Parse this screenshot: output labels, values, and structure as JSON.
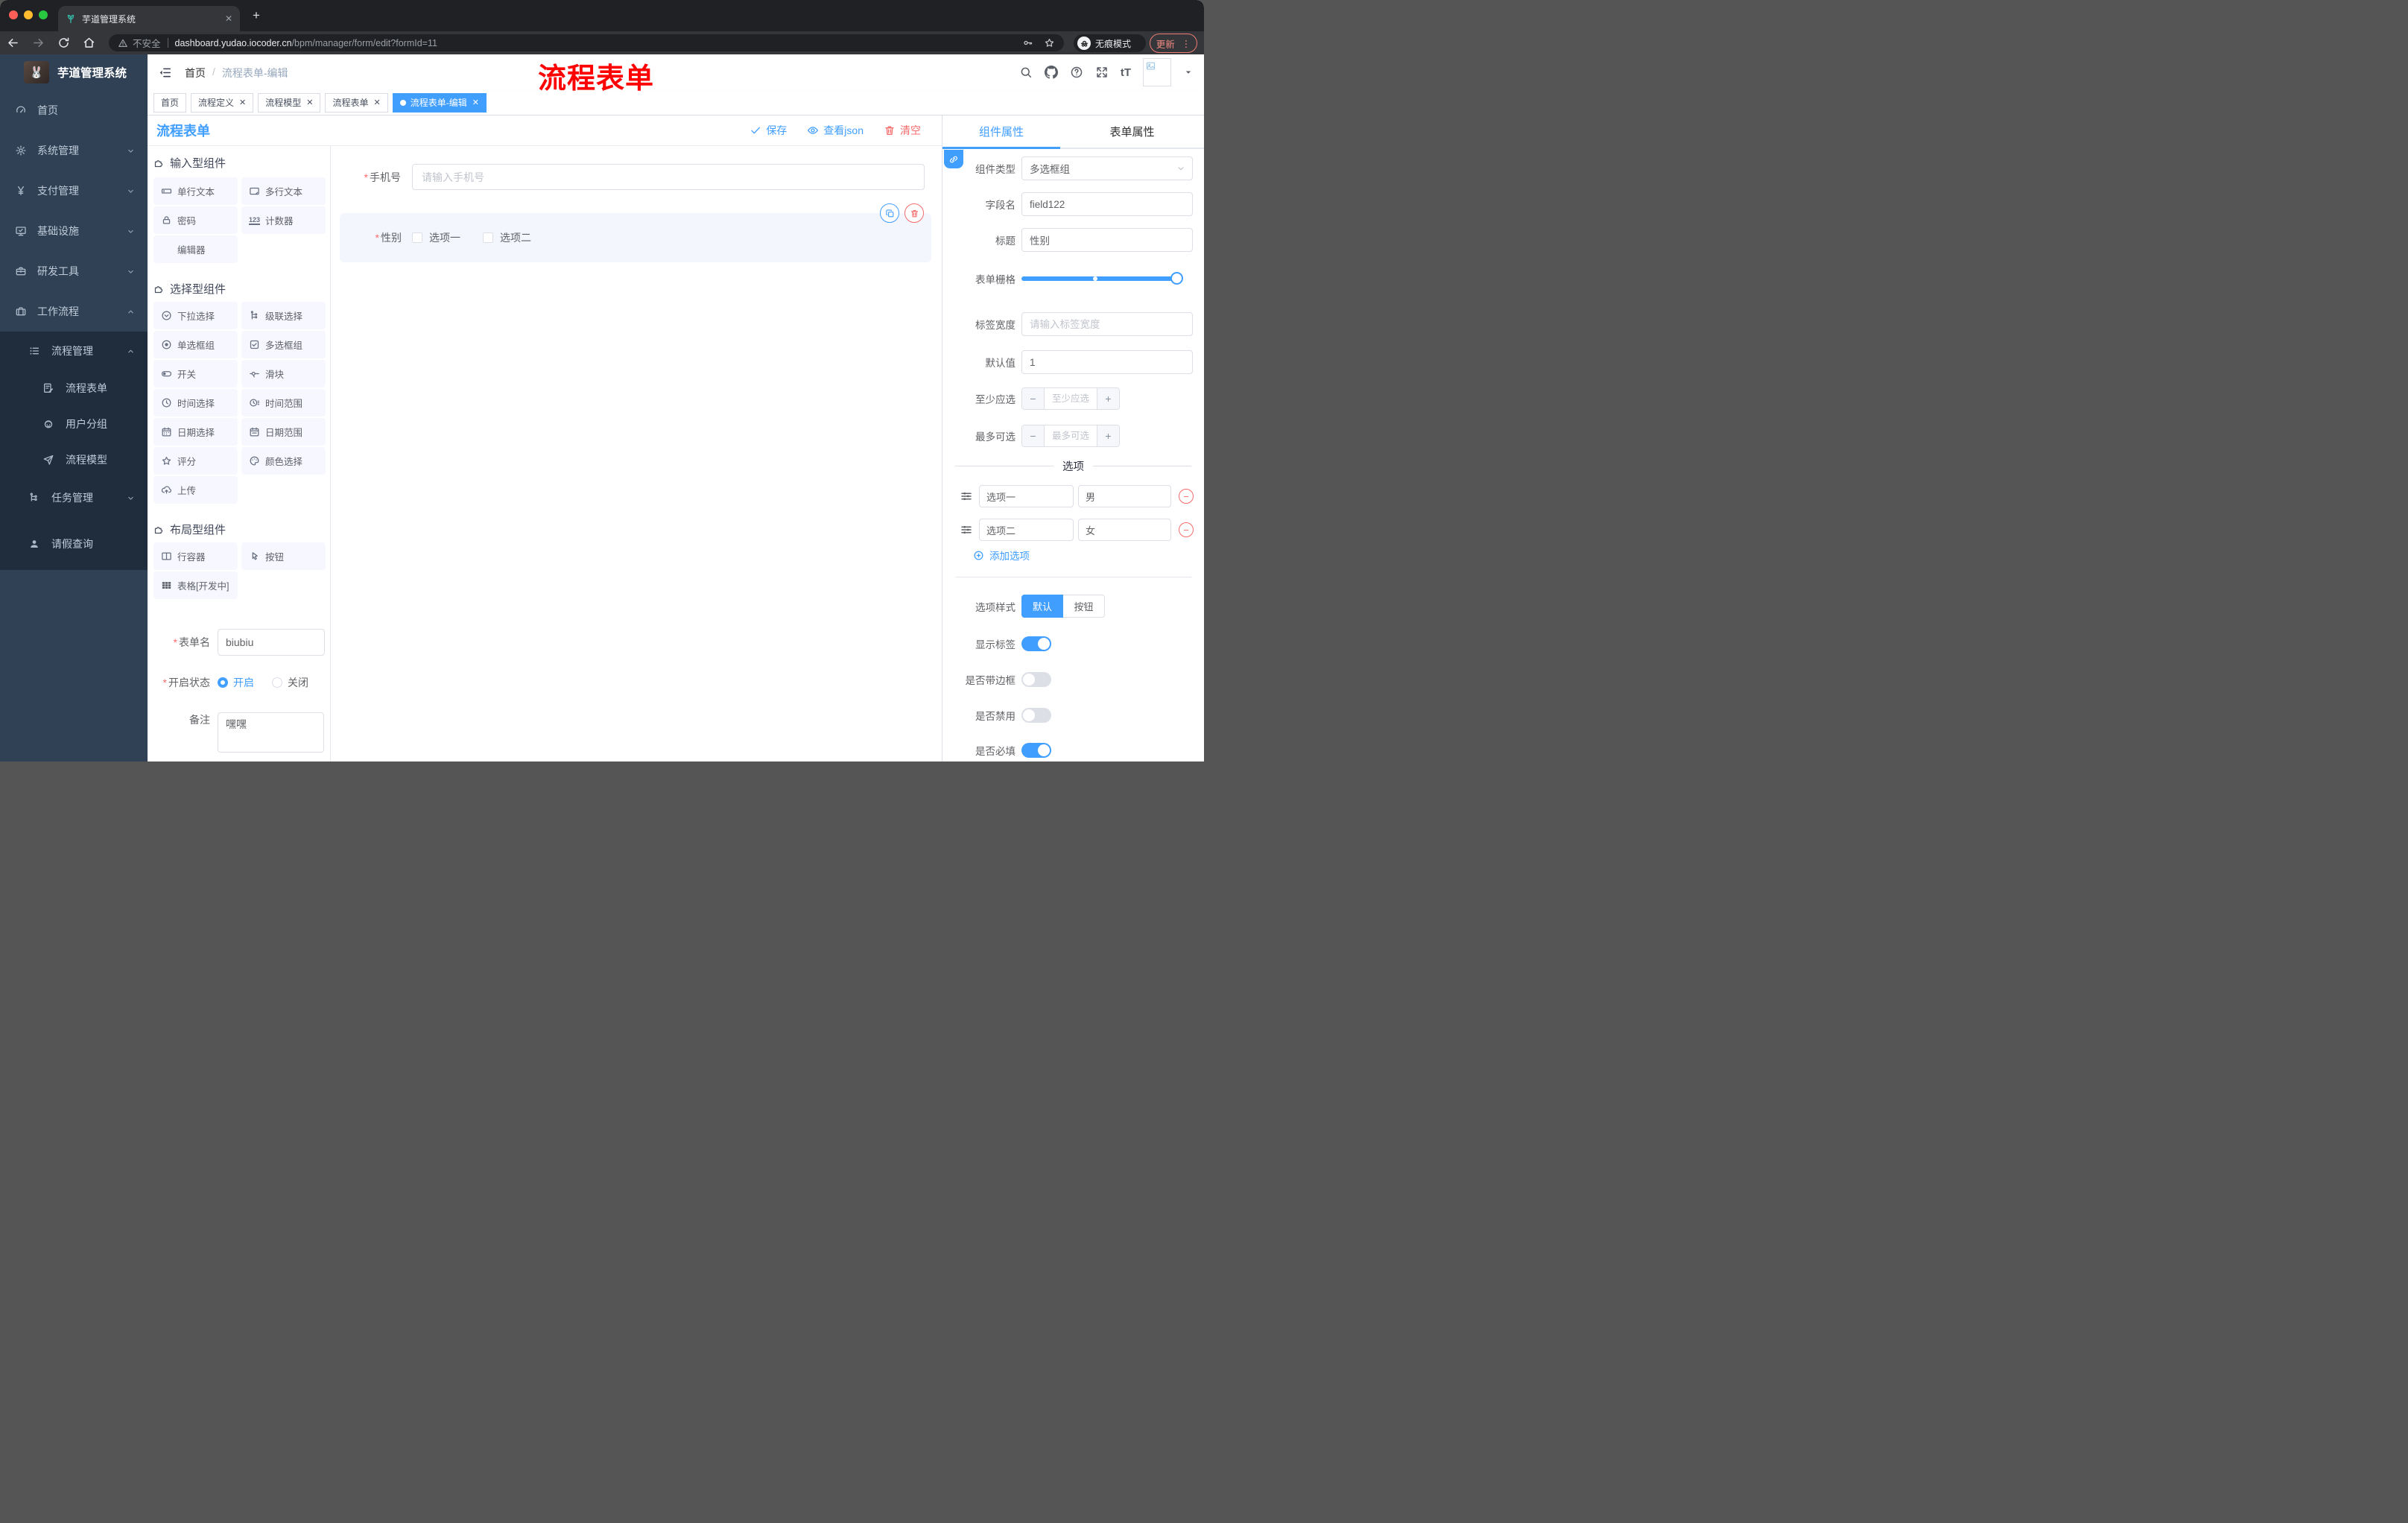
{
  "browser": {
    "tab_title": "芋道管理系统",
    "close_glyph": "✕",
    "new_tab_glyph": "+",
    "not_secure": "不安全",
    "url_host": "dashboard.yudao.iocoder.cn",
    "url_path": "/bpm/manager/form/edit?formId=11",
    "incognito_label": "无痕模式",
    "update_label": "更新",
    "menu_dots": "⋮"
  },
  "sidebar": {
    "title": "芋道管理系统",
    "items": [
      {
        "label": "首页"
      },
      {
        "label": "系统管理"
      },
      {
        "label": "支付管理"
      },
      {
        "label": "基础设施"
      },
      {
        "label": "研发工具"
      },
      {
        "label": "工作流程"
      },
      {
        "label": "流程管理"
      },
      {
        "label": "流程表单"
      },
      {
        "label": "用户分组"
      },
      {
        "label": "流程模型"
      },
      {
        "label": "任务管理"
      },
      {
        "label": "请假查询"
      }
    ]
  },
  "header": {
    "breadcrumb_home": "首页",
    "breadcrumb_sep": "/",
    "breadcrumb_current": "流程表单-编辑",
    "annotation": "流程表单",
    "font_icon": "tT"
  },
  "tags": [
    {
      "label": "首页",
      "closable": false,
      "active": false
    },
    {
      "label": "流程定义",
      "closable": true,
      "active": false
    },
    {
      "label": "流程模型",
      "closable": true,
      "active": false
    },
    {
      "label": "流程表单",
      "closable": true,
      "active": false
    },
    {
      "label": "流程表单-编辑",
      "closable": true,
      "active": true
    }
  ],
  "editor": {
    "title": "流程表单",
    "save": "保存",
    "view_json": "查看json",
    "clear": "清空"
  },
  "components": {
    "sections": [
      {
        "title": "输入型组件",
        "items": [
          {
            "label": "单行文本"
          },
          {
            "label": "多行文本"
          },
          {
            "label": "密码"
          },
          {
            "label": "计数器"
          },
          {
            "label": "编辑器"
          }
        ]
      },
      {
        "title": "选择型组件",
        "items": [
          {
            "label": "下拉选择"
          },
          {
            "label": "级联选择"
          },
          {
            "label": "单选框组"
          },
          {
            "label": "多选框组"
          },
          {
            "label": "开关"
          },
          {
            "label": "滑块"
          },
          {
            "label": "时间选择"
          },
          {
            "label": "时间范围"
          },
          {
            "label": "日期选择"
          },
          {
            "label": "日期范围"
          },
          {
            "label": "评分"
          },
          {
            "label": "颜色选择"
          },
          {
            "label": "上传"
          }
        ]
      },
      {
        "title": "布局型组件",
        "items": [
          {
            "label": "行容器"
          },
          {
            "label": "按钮"
          },
          {
            "label": "表格[开发中]"
          }
        ]
      }
    ],
    "counter_glyph": "123"
  },
  "form_settings": {
    "name_label": "表单名",
    "name_value": "biubiu",
    "status_label": "开启状态",
    "status_on": "开启",
    "status_off": "关闭",
    "remark_label": "备注",
    "remark_value": "嘿嘿"
  },
  "canvas": {
    "phone_label": "手机号",
    "phone_placeholder": "请输入手机号",
    "gender_label": "性别",
    "gender_option1": "选项一",
    "gender_option2": "选项二"
  },
  "props": {
    "tab_component": "组件属性",
    "tab_form": "表单属性",
    "type_label": "组件类型",
    "type_value": "多选框组",
    "field_label": "字段名",
    "field_value": "field122",
    "title_label": "标题",
    "title_value": "性别",
    "grid_label": "表单栅格",
    "width_label": "标签宽度",
    "width_placeholder": "请输入标签宽度",
    "default_label": "默认值",
    "default_value": "1",
    "min_label": "至少应选",
    "min_placeholder": "至少应选",
    "max_label": "最多可选",
    "max_placeholder": "最多可选",
    "minus_glyph": "−",
    "plus_glyph": "+",
    "options_title": "选项",
    "option1_name": "选项一",
    "option1_value": "男",
    "option2_name": "选项二",
    "option2_value": "女",
    "remove_glyph": "−",
    "add_option": "添加选项",
    "style_label": "选项样式",
    "style_default": "默认",
    "style_button": "按钮",
    "toggle1": "显示标签",
    "toggle2": "是否带边框",
    "toggle3": "是否禁用",
    "toggle4": "是否必填"
  },
  "colors": {
    "accent": "#409eff",
    "danger": "#f56c6c",
    "annotation": "#fd0202",
    "sidebar": "#304156",
    "submenu": "#1f2d3d"
  }
}
